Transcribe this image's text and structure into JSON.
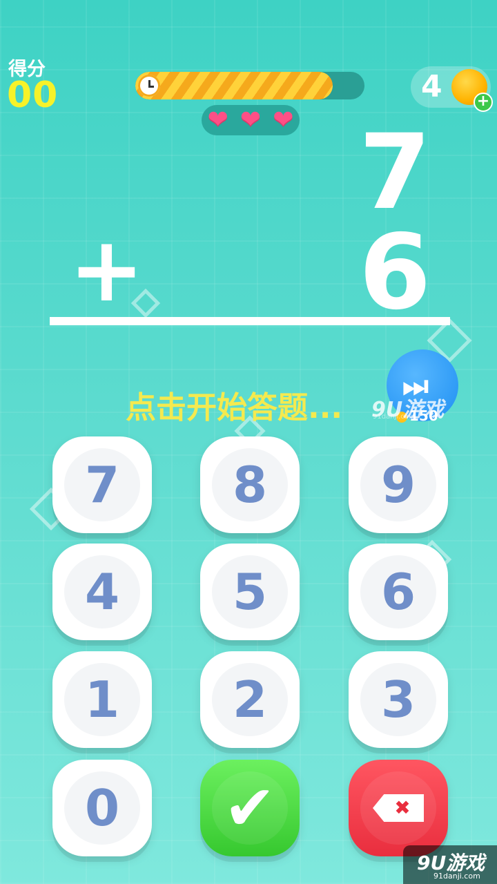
{
  "score": {
    "label": "得分",
    "value": "00"
  },
  "timer": {
    "fraction": 0.86
  },
  "lives": [
    "❤",
    "❤",
    "❤"
  ],
  "coins": {
    "count": "4",
    "plus": "+"
  },
  "problem": {
    "top": "7",
    "operator": "+",
    "bottom": "6"
  },
  "prompt": "点击开始答题...",
  "skip": {
    "icon": "⏭",
    "cost": "150"
  },
  "keypad": {
    "k7": "7",
    "k8": "8",
    "k9": "9",
    "k4": "4",
    "k5": "5",
    "k6": "6",
    "k1": "1",
    "k2": "2",
    "k3": "3",
    "k0": "0",
    "confirm": "✔",
    "delete": "✖"
  },
  "watermark": {
    "mid": "9U游戏",
    "mid_sub": "91danji.com",
    "bottom": "9U游戏",
    "bottom_sub": "91danji.com"
  },
  "colors": {
    "background": "#3ed2c4",
    "score": "#f7f229",
    "prompt": "#f4ea4f",
    "confirm": "#36c82f",
    "delete": "#e92e3e",
    "skip": "#1e8ff2",
    "digit": "#6f8ec9"
  }
}
